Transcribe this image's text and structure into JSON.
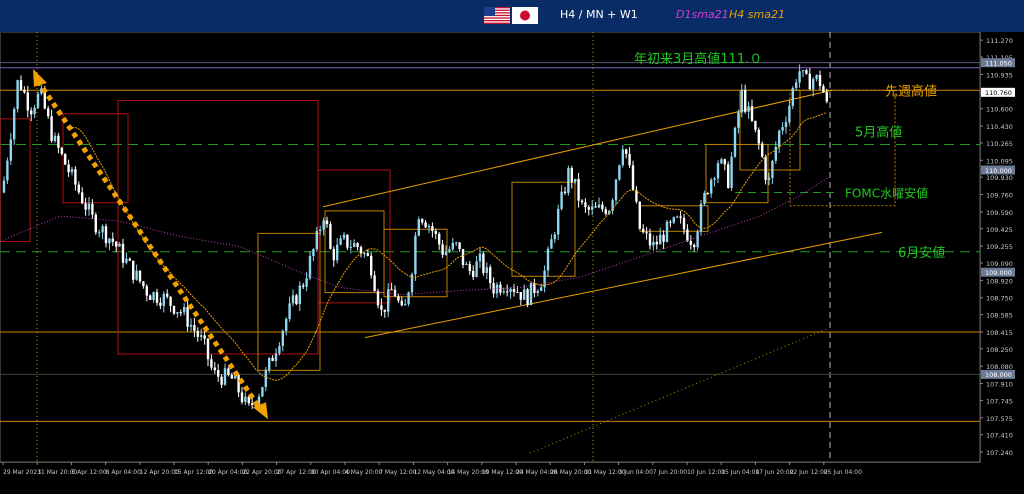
{
  "header": {
    "title": "H4 / MN + W1",
    "legend_d1": "D1sma21",
    "legend_h4": "H4 sma21",
    "flags": [
      "us-flag-icon",
      "japan-flag-icon"
    ]
  },
  "colors": {
    "header_bg": "#0a2c66",
    "background": "#000000",
    "bull_candle": "#8fd6f0",
    "bear_candle": "#ffffff",
    "d1_sma": "#c040c0",
    "h4_sma": "#e8a000",
    "channel": "#e8a000",
    "annotation_green": "#22c522",
    "arrow": "#f0a000",
    "box_red": "#b01010",
    "box_orange": "#c08000",
    "level_orange": "#d08000",
    "purple_level": "#8060c0"
  },
  "annotations": [
    {
      "text": "年初来3月高値111.０",
      "price": 111.0,
      "color": "#22c522"
    },
    {
      "text": "先週高値",
      "price": 110.78,
      "color": "#e8a000"
    },
    {
      "text": "5月高値",
      "price": 110.25,
      "color": "#22c522"
    },
    {
      "text": "FOMC水曜安値",
      "price": 109.78,
      "color": "#22c522"
    },
    {
      "text": "6月安値",
      "price": 109.2,
      "color": "#22c522"
    }
  ],
  "chart_data": {
    "type": "candlestick",
    "title": "",
    "ylim": [
      107.23,
      111.32
    ],
    "y_ticks": [
      "111.270",
      "111.105",
      "110.935",
      "110.760",
      "110.600",
      "110.430",
      "110.265",
      "110.095",
      "109.930",
      "109.760",
      "109.590",
      "109.425",
      "109.255",
      "109.090",
      "108.920",
      "108.750",
      "108.585",
      "108.415",
      "108.250",
      "108.080",
      "107.910",
      "107.745",
      "107.575",
      "107.410",
      "107.240"
    ],
    "y_tick_values": [
      111.27,
      111.105,
      110.935,
      110.76,
      110.6,
      110.43,
      110.265,
      110.095,
      109.93,
      109.76,
      109.59,
      109.425,
      109.255,
      109.09,
      108.92,
      108.75,
      108.585,
      108.415,
      108.25,
      108.08,
      107.91,
      107.745,
      107.575,
      107.41,
      107.24
    ],
    "price_tags": [
      {
        "label": "111.050",
        "value": 111.05,
        "color": "#6b7a96"
      },
      {
        "label": "110.760",
        "value": 110.76,
        "color": "#ffffff"
      },
      {
        "label": "110.000",
        "value": 110.0,
        "color": "#6b7a96"
      },
      {
        "label": "109.000",
        "value": 109.0,
        "color": "#6b7a96"
      },
      {
        "label": "108.000",
        "value": 108.0,
        "color": "#6b7a96"
      }
    ],
    "x_labels": [
      "29 Mar 2021",
      "31 Mar 20:00",
      "5 Apr 12:00",
      "8 Apr 04:00",
      "12 Apr 20:00",
      "15 Apr 12:00",
      "20 Apr 04:00",
      "22 Apr 20:00",
      "27 Apr 12:00",
      "30 Apr 04:00",
      "4 May 20:00",
      "7 May 12:00",
      "12 May 04:00",
      "14 May 20:00",
      "19 May 12:00",
      "24 May 04:00",
      "26 May 20:00",
      "31 May 12:00",
      "3 Jun 04:00",
      "7 Jun 20:00",
      "10 Jun 12:00",
      "15 Jun 04:00",
      "17 Jun 20:00",
      "22 Jun 12:00",
      "25 Jun 04:00"
    ],
    "waypoints": [
      [
        0,
        109.5
      ],
      [
        10,
        110.2
      ],
      [
        20,
        110.9
      ],
      [
        32,
        110.6
      ],
      [
        42,
        110.75
      ],
      [
        55,
        110.3
      ],
      [
        75,
        109.9
      ],
      [
        95,
        109.5
      ],
      [
        115,
        109.3
      ],
      [
        135,
        109.0
      ],
      [
        150,
        108.8
      ],
      [
        165,
        108.75
      ],
      [
        185,
        108.6
      ],
      [
        205,
        108.3
      ],
      [
        215,
        108.0
      ],
      [
        235,
        107.95
      ],
      [
        250,
        107.65
      ],
      [
        262,
        107.85
      ],
      [
        275,
        108.2
      ],
      [
        290,
        108.6
      ],
      [
        305,
        108.9
      ],
      [
        318,
        109.3
      ],
      [
        326,
        109.6
      ],
      [
        333,
        109.15
      ],
      [
        345,
        109.3
      ],
      [
        360,
        109.25
      ],
      [
        372,
        109.1
      ],
      [
        383,
        108.6
      ],
      [
        395,
        108.85
      ],
      [
        405,
        108.55
      ],
      [
        413,
        109.0
      ],
      [
        420,
        109.6
      ],
      [
        432,
        109.45
      ],
      [
        445,
        109.2
      ],
      [
        458,
        109.25
      ],
      [
        470,
        109.0
      ],
      [
        482,
        109.1
      ],
      [
        495,
        108.85
      ],
      [
        510,
        108.9
      ],
      [
        528,
        108.75
      ],
      [
        545,
        108.95
      ],
      [
        558,
        109.5
      ],
      [
        571,
        110.0
      ],
      [
        585,
        109.6
      ],
      [
        598,
        109.6
      ],
      [
        612,
        109.65
      ],
      [
        625,
        110.3
      ],
      [
        633,
        109.9
      ],
      [
        642,
        109.4
      ],
      [
        655,
        109.25
      ],
      [
        668,
        109.4
      ],
      [
        680,
        109.5
      ],
      [
        695,
        109.3
      ],
      [
        708,
        109.8
      ],
      [
        720,
        110.1
      ],
      [
        730,
        109.9
      ],
      [
        743,
        110.75
      ],
      [
        752,
        110.5
      ],
      [
        762,
        110.2
      ],
      [
        770,
        109.85
      ],
      [
        780,
        110.35
      ],
      [
        790,
        110.6
      ],
      [
        800,
        111.0
      ],
      [
        807,
        110.85
      ],
      [
        816,
        110.9
      ],
      [
        823,
        110.85
      ],
      [
        829,
        110.6
      ]
    ]
  }
}
